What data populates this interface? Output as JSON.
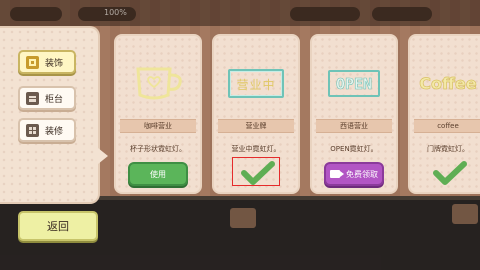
{
  "top_hud": {
    "percent": "100%"
  },
  "sidebar": {
    "items": [
      {
        "label": "装饰",
        "icon": "decoration-icon",
        "active": true
      },
      {
        "label": "柜台",
        "icon": "counter-icon",
        "active": false
      },
      {
        "label": "装修",
        "icon": "renovation-icon",
        "active": false
      }
    ]
  },
  "cards": [
    {
      "title": "咖啡营业",
      "desc": "杯子形状霓虹灯。",
      "action": "使用",
      "art_icon": "coffee-cup-neon-icon"
    },
    {
      "title": "营业牌",
      "desc": "营业中霓虹灯。",
      "art_text": "营业中",
      "state_icon": "checkmark-icon"
    },
    {
      "title": "西语营业",
      "desc": "OPEN霓虹灯。",
      "art_text": "OPEN",
      "action": "免费领取",
      "action_icon": "video-icon"
    },
    {
      "title": "coffee",
      "desc": "门牌霓虹灯。",
      "art_text": "Coffee",
      "state_icon": "checkmark-icon"
    }
  ],
  "return_label": "返回",
  "colors": {
    "accent_green": "#5bb55a",
    "accent_purple": "#b255c4",
    "highlight_red": "#e52b2b",
    "panel_bg": "#f2dfd0"
  }
}
